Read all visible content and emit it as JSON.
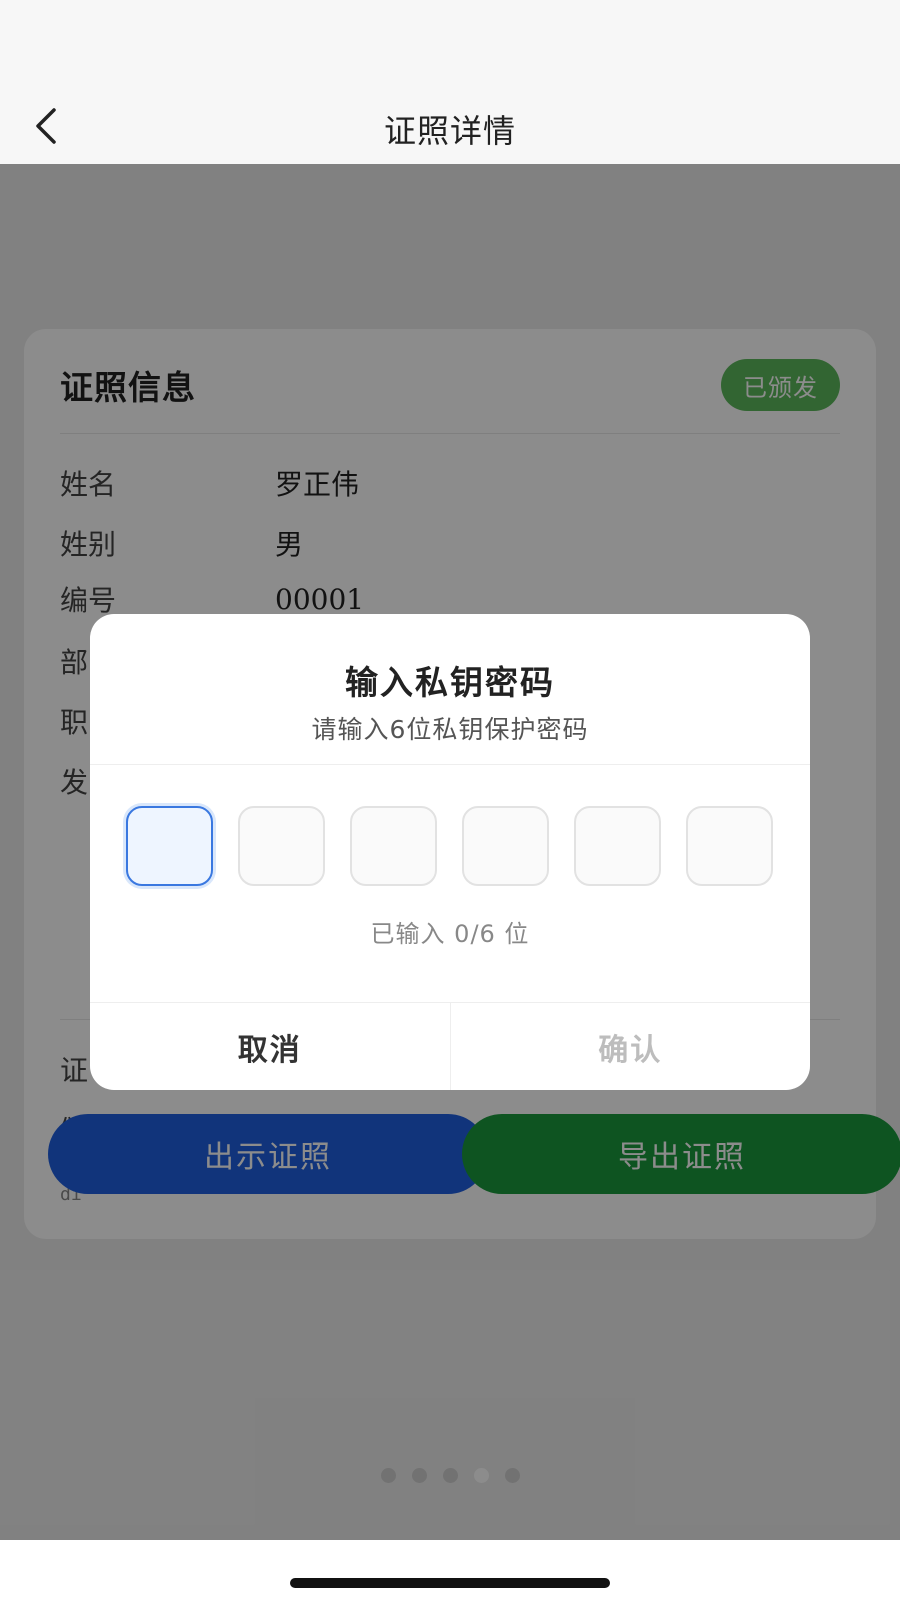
{
  "header": {
    "title": "证照详情"
  },
  "card": {
    "title": "证照信息",
    "status_badge": "已颁发",
    "fields": [
      {
        "label": "姓名",
        "value": "罗正伟"
      },
      {
        "label": "姓别",
        "value": "男"
      },
      {
        "label": "编号",
        "value": "00001"
      },
      {
        "label": "部",
        "value": ""
      },
      {
        "label": "职",
        "value": ""
      },
      {
        "label": "发",
        "value": ""
      }
    ],
    "lower_fields": [
      {
        "label": "证",
        "value": ""
      },
      {
        "label": "颁",
        "value": ""
      }
    ],
    "mono_text": "di"
  },
  "actions": {
    "show_label": "出示证照",
    "export_label": "导出证照"
  },
  "colors": {
    "primary_blue": "#2060e0",
    "primary_green": "#1a9a3c",
    "badge_green": "#5cb85c"
  },
  "pager": {
    "count": 5,
    "active_index": 3
  },
  "dialog": {
    "title": "输入私钥密码",
    "subtitle": "请输入6位私钥保护密码",
    "pin_length": 6,
    "entered_text": "已输入 0/6 位",
    "cancel_label": "取消",
    "confirm_label": "确认"
  }
}
